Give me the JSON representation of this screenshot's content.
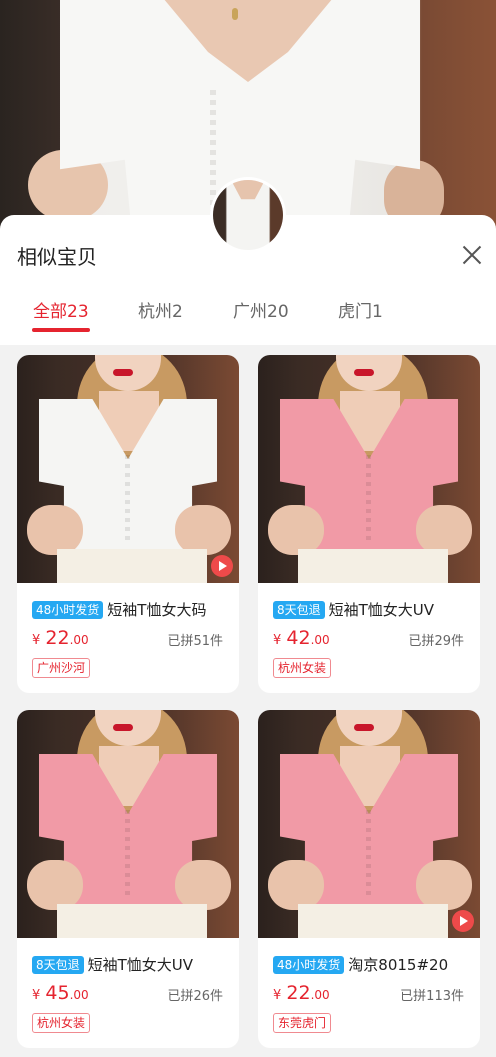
{
  "sheet": {
    "title": "相似宝贝"
  },
  "tabs": [
    {
      "label": "全部23",
      "active": true
    },
    {
      "label": "杭州2",
      "active": false
    },
    {
      "label": "广州20",
      "active": false
    },
    {
      "label": "虎门1",
      "active": false
    }
  ],
  "products": [
    {
      "badge": "48小时发货",
      "name": "短袖T恤女大码",
      "price_currency": "¥",
      "price_int": "22",
      "price_dec": ".00",
      "sold": "已拼51件",
      "tag": "广州沙河",
      "color": "white",
      "video": true
    },
    {
      "badge": "8天包退",
      "name": "短袖T恤女大UV",
      "price_currency": "¥",
      "price_int": "42",
      "price_dec": ".00",
      "sold": "已拼29件",
      "tag": "杭州女装",
      "color": "pink",
      "video": false
    },
    {
      "badge": "8天包退",
      "name": "短袖T恤女大UV",
      "price_currency": "¥",
      "price_int": "45",
      "price_dec": ".00",
      "sold": "已拼26件",
      "tag": "杭州女装",
      "color": "pink",
      "video": false
    },
    {
      "badge": "48小时发货",
      "name": "淘京8015#20",
      "price_currency": "¥",
      "price_int": "22",
      "price_dec": ".00",
      "sold": "已拼113件",
      "tag": "东莞虎门",
      "color": "pink",
      "video": true
    }
  ],
  "colors": {
    "accent": "#e5242f",
    "badge_blue": "#25a8f2",
    "shirt_white": "#f5f5f3",
    "shirt_pink": "#f19aa6"
  }
}
